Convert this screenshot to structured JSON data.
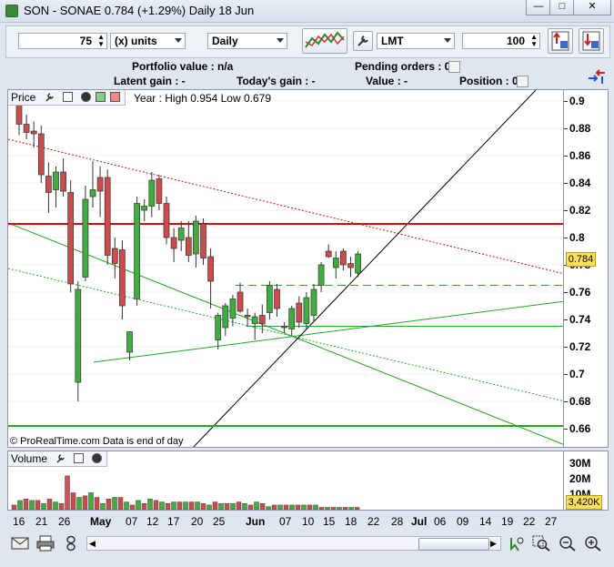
{
  "window": {
    "title": "SON - SONAE   0.784 (+1.29%)   Daily  18 Jun",
    "minimize": "—",
    "maximize": "□",
    "close": "✕"
  },
  "toolbar": {
    "quantity": "75",
    "unit_select": "(x) units",
    "period_select": "Daily",
    "order_type_select": "LMT",
    "order_qty": "100"
  },
  "account": {
    "portfolio_label": "Portfolio value : n/a",
    "pending_label": "Pending orders : 0",
    "latent_label": "Latent gain : -",
    "today_label": "Today's gain : -",
    "value_label": "Value : -",
    "position_label": "Position : 0"
  },
  "price_panel": {
    "label": "Price",
    "info": "Year : High 0.954 Low 0.679",
    "footer": "© ProRealTime.com  Data is end of day",
    "current_price": "0.784",
    "y_ticks": [
      "0.9",
      "0.88",
      "0.86",
      "0.84",
      "0.82",
      "0.8",
      "0.78",
      "0.76",
      "0.74",
      "0.72",
      "0.7",
      "0.68",
      "0.66"
    ]
  },
  "volume_panel": {
    "label": "Volume",
    "y_ticks": [
      "30M",
      "20M",
      "10M"
    ],
    "current_volume": "3,420K"
  },
  "x_axis": {
    "labels": [
      "16",
      "21",
      "26",
      "May",
      "07",
      "12",
      "17",
      "20",
      "25",
      "Jun",
      "07",
      "10",
      "15",
      "18",
      "22",
      "28",
      "Jul",
      "06",
      "09",
      "14",
      "19",
      "22",
      "27"
    ]
  },
  "colors": {
    "up": "#3fae3f",
    "down": "#cc4b4b",
    "resistance": "#cc1111",
    "support": "#22aa22",
    "price_badge": "#ffe060"
  },
  "chart_data": {
    "type": "candlestick",
    "title": "SON - SONAE",
    "ylim": [
      0.65,
      0.91
    ],
    "candles": [
      {
        "o": 0.9,
        "h": 0.905,
        "l": 0.875,
        "c": 0.883
      },
      {
        "o": 0.883,
        "h": 0.89,
        "l": 0.872,
        "c": 0.877
      },
      {
        "o": 0.878,
        "h": 0.885,
        "l": 0.866,
        "c": 0.876
      },
      {
        "o": 0.876,
        "h": 0.882,
        "l": 0.84,
        "c": 0.846
      },
      {
        "o": 0.845,
        "h": 0.855,
        "l": 0.818,
        "c": 0.833
      },
      {
        "o": 0.835,
        "h": 0.852,
        "l": 0.822,
        "c": 0.848
      },
      {
        "o": 0.848,
        "h": 0.858,
        "l": 0.83,
        "c": 0.834
      },
      {
        "o": 0.833,
        "h": 0.842,
        "l": 0.76,
        "c": 0.766
      },
      {
        "o": 0.694,
        "h": 0.768,
        "l": 0.68,
        "c": 0.762
      },
      {
        "o": 0.771,
        "h": 0.838,
        "l": 0.768,
        "c": 0.828
      },
      {
        "o": 0.83,
        "h": 0.856,
        "l": 0.822,
        "c": 0.835
      },
      {
        "o": 0.844,
        "h": 0.852,
        "l": 0.815,
        "c": 0.834
      },
      {
        "o": 0.844,
        "h": 0.85,
        "l": 0.78,
        "c": 0.787
      },
      {
        "o": 0.792,
        "h": 0.8,
        "l": 0.77,
        "c": 0.781
      },
      {
        "o": 0.791,
        "h": 0.798,
        "l": 0.74,
        "c": 0.75
      },
      {
        "o": 0.716,
        "h": 0.73,
        "l": 0.71,
        "c": 0.731
      },
      {
        "o": 0.755,
        "h": 0.83,
        "l": 0.75,
        "c": 0.825
      },
      {
        "o": 0.82,
        "h": 0.828,
        "l": 0.812,
        "c": 0.823
      },
      {
        "o": 0.823,
        "h": 0.848,
        "l": 0.815,
        "c": 0.842
      },
      {
        "o": 0.843,
        "h": 0.846,
        "l": 0.82,
        "c": 0.825
      },
      {
        "o": 0.825,
        "h": 0.83,
        "l": 0.795,
        "c": 0.8
      },
      {
        "o": 0.8,
        "h": 0.807,
        "l": 0.782,
        "c": 0.792
      },
      {
        "o": 0.798,
        "h": 0.812,
        "l": 0.79,
        "c": 0.807
      },
      {
        "o": 0.8,
        "h": 0.812,
        "l": 0.782,
        "c": 0.787
      },
      {
        "o": 0.788,
        "h": 0.816,
        "l": 0.778,
        "c": 0.812
      },
      {
        "o": 0.81,
        "h": 0.814,
        "l": 0.78,
        "c": 0.785
      },
      {
        "o": 0.786,
        "h": 0.792,
        "l": 0.748,
        "c": 0.768
      },
      {
        "o": 0.725,
        "h": 0.745,
        "l": 0.718,
        "c": 0.743
      },
      {
        "o": 0.734,
        "h": 0.752,
        "l": 0.728,
        "c": 0.75
      },
      {
        "o": 0.741,
        "h": 0.758,
        "l": 0.735,
        "c": 0.755
      },
      {
        "o": 0.76,
        "h": 0.767,
        "l": 0.745,
        "c": 0.746
      },
      {
        "o": 0.743,
        "h": 0.748,
        "l": 0.735,
        "c": 0.742
      },
      {
        "o": 0.737,
        "h": 0.745,
        "l": 0.725,
        "c": 0.742
      },
      {
        "o": 0.743,
        "h": 0.751,
        "l": 0.73,
        "c": 0.737
      },
      {
        "o": 0.745,
        "h": 0.768,
        "l": 0.74,
        "c": 0.765
      },
      {
        "o": 0.762,
        "h": 0.766,
        "l": 0.742,
        "c": 0.748
      },
      {
        "o": 0.735,
        "h": 0.738,
        "l": 0.73,
        "c": 0.734
      },
      {
        "o": 0.733,
        "h": 0.75,
        "l": 0.728,
        "c": 0.748
      },
      {
        "o": 0.752,
        "h": 0.757,
        "l": 0.734,
        "c": 0.738
      },
      {
        "o": 0.737,
        "h": 0.76,
        "l": 0.733,
        "c": 0.756
      },
      {
        "o": 0.743,
        "h": 0.766,
        "l": 0.738,
        "c": 0.762
      },
      {
        "o": 0.765,
        "h": 0.782,
        "l": 0.76,
        "c": 0.78
      },
      {
        "o": 0.79,
        "h": 0.795,
        "l": 0.785,
        "c": 0.786
      },
      {
        "o": 0.778,
        "h": 0.79,
        "l": 0.77,
        "c": 0.785
      },
      {
        "o": 0.79,
        "h": 0.792,
        "l": 0.776,
        "c": 0.78
      },
      {
        "o": 0.781,
        "h": 0.786,
        "l": 0.771,
        "c": 0.778
      },
      {
        "o": 0.774,
        "h": 0.79,
        "l": 0.771,
        "c": 0.788
      }
    ],
    "volumes": [
      3,
      6,
      7,
      6,
      6,
      4,
      7,
      5,
      4,
      22,
      11,
      8,
      9,
      11,
      8,
      4,
      7,
      8,
      8,
      5,
      3,
      6,
      4,
      7,
      6,
      5,
      4,
      5,
      5,
      5,
      5,
      5,
      4,
      3,
      5,
      4,
      4,
      4,
      5,
      4,
      3,
      5,
      4,
      2,
      3,
      3,
      3,
      3,
      3,
      3,
      3,
      3,
      1.5,
      1.5,
      1.5,
      1.5,
      1.5,
      1.5,
      1.5
    ],
    "volume_ylim": [
      0,
      32
    ]
  }
}
